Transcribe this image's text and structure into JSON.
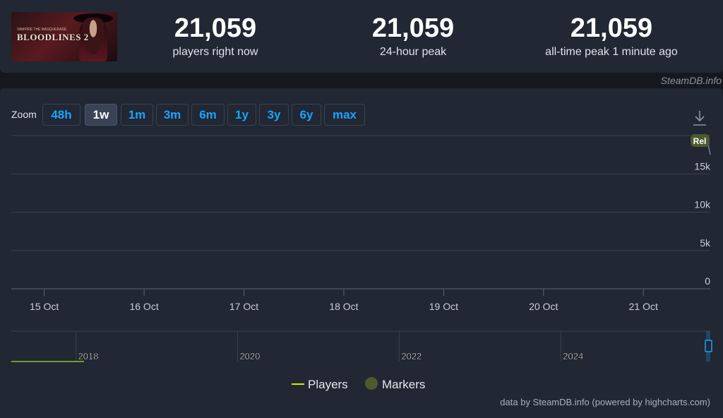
{
  "header": {
    "game_logo_text": "BLOODLINES 2",
    "game_logo_small": "VAMPIRE THE MASQUERADE",
    "stats": [
      {
        "value": "21,059",
        "label": "players right now"
      },
      {
        "value": "21,059",
        "label": "24-hour peak"
      },
      {
        "value": "21,059",
        "label": "all-time peak 1 minute ago"
      }
    ],
    "watermark": "SteamDB.info"
  },
  "zoom": {
    "label": "Zoom",
    "buttons": [
      "48h",
      "1w",
      "1m",
      "3m",
      "6m",
      "1y",
      "3y",
      "6y",
      "max"
    ],
    "active": "1w"
  },
  "toolbar": {
    "download_icon": "download-icon"
  },
  "chart_data": {
    "type": "line",
    "title": "",
    "x_tick_labels": [
      "15 Oct",
      "16 Oct",
      "17 Oct",
      "18 Oct",
      "19 Oct",
      "20 Oct",
      "21 Oct"
    ],
    "y_tick_labels": [
      "0",
      "5k",
      "10k",
      "15k"
    ],
    "ylim": [
      0,
      20000
    ],
    "y_ticks": [
      0,
      5000,
      10000,
      15000,
      20000
    ],
    "x_tick_days": [
      15,
      16,
      17,
      18,
      19,
      20,
      21
    ],
    "x_range_days": [
      14.67,
      21.67
    ],
    "series": [
      {
        "name": "Players",
        "color": "#c8f000",
        "points": [
          {
            "x": 21.63,
            "y": 21059
          },
          {
            "x": 21.67,
            "y": 17500
          }
        ]
      }
    ],
    "marker": {
      "label": "Rel",
      "color": "#4d5a2e"
    },
    "navigator": {
      "labels": [
        "2018",
        "2020",
        "2022",
        "2024"
      ],
      "year_range": [
        2017.2,
        2025.85
      ],
      "label_years": [
        2018,
        2020,
        2022,
        2024
      ]
    },
    "legend": {
      "position": "bottom-center",
      "items": [
        {
          "name": "Players",
          "color": "#c8f000",
          "shape": "line"
        },
        {
          "name": "Markers",
          "color": "#4d5a2e",
          "shape": "circle"
        }
      ]
    },
    "grid": true,
    "colors": {
      "grid": "#3a4150",
      "axis_text": "#c9ced8",
      "navigator_line": "#6aa322"
    }
  },
  "footer": {
    "credit": "data by SteamDB.info (powered by highcharts.com)"
  }
}
